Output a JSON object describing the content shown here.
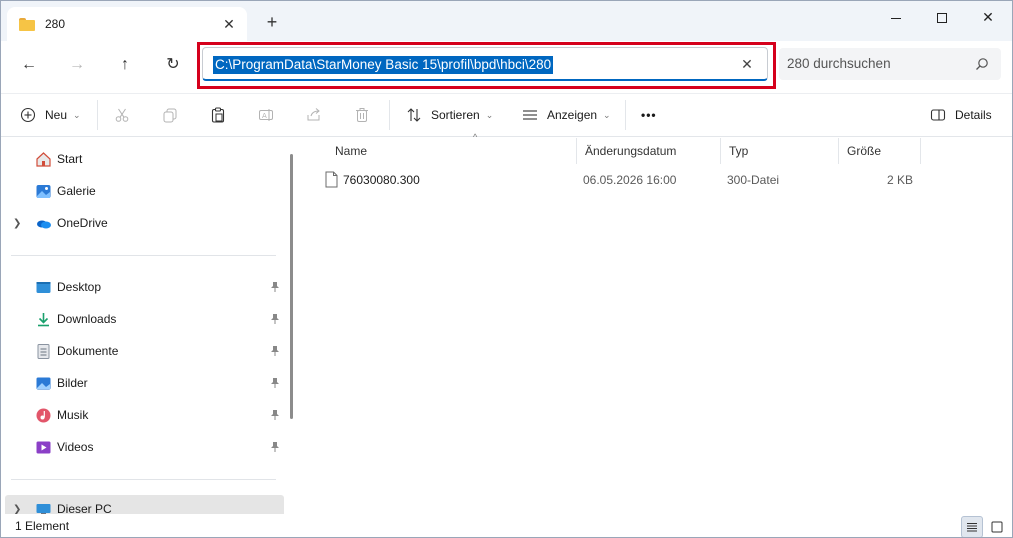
{
  "window": {
    "tab_title": "280",
    "tab_close": "✕",
    "tab_add": "+",
    "minimize": "",
    "maximize": "",
    "close": "✕"
  },
  "nav": {
    "back": "←",
    "forward": "→",
    "up": "↑",
    "refresh": "↻",
    "address": "C:\\ProgramData\\StarMoney Basic 15\\profil\\bpd\\hbci\\280",
    "address_clear": "✕",
    "search_placeholder": "280 durchsuchen"
  },
  "commands": {
    "new": "Neu",
    "sort": "Sortieren",
    "view": "Anzeigen",
    "more": "•••",
    "details": "Details"
  },
  "sidebar": {
    "items": [
      {
        "label": "Start",
        "icon": "home-icon"
      },
      {
        "label": "Galerie",
        "icon": "gallery-icon"
      },
      {
        "label": "OneDrive",
        "icon": "onedrive-icon"
      },
      {
        "label": "Desktop",
        "icon": "desktop-icon"
      },
      {
        "label": "Downloads",
        "icon": "downloads-icon"
      },
      {
        "label": "Dokumente",
        "icon": "documents-icon"
      },
      {
        "label": "Bilder",
        "icon": "pictures-icon"
      },
      {
        "label": "Musik",
        "icon": "music-icon"
      },
      {
        "label": "Videos",
        "icon": "videos-icon"
      },
      {
        "label": "Dieser PC",
        "icon": "this-pc-icon"
      }
    ]
  },
  "columns": {
    "name": "Name",
    "modified": "Änderungsdatum",
    "type": "Typ",
    "size": "Größe"
  },
  "files": [
    {
      "name": "76030080.300",
      "modified": "06.05.2026 16:00",
      "type": "300-Datei",
      "size": "2 KB"
    }
  ],
  "status": {
    "count": "1 Element"
  },
  "colors": {
    "accent": "#0067c0",
    "highlight_border": "#d5001c",
    "folder": "#f6c445"
  }
}
